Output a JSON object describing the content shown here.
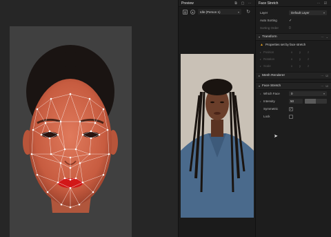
{
  "preview": {
    "title": "Preview",
    "device": "Idle (Person 1)",
    "toolbar_icons": [
      "frame-icon",
      "camera-icon",
      "refresh-icon"
    ]
  },
  "inspector": {
    "title": "Face Stretch",
    "layer_label": "Layer",
    "layer_value": "Default Layer",
    "auto_sorting_label": "Auto Sorting",
    "sorting_order_label": "Sorting Order",
    "transform": {
      "title": "Transform",
      "warning": "Properties set by face stretch",
      "position_label": "Position",
      "rotation_label": "Rotation",
      "scale_label": "Scale"
    },
    "mesh_renderer": {
      "title": "Mesh Renderer"
    },
    "face_stretch": {
      "title": "Face Stretch",
      "which_face_label": "Which Face",
      "which_face_value": "0",
      "intensity_label": "Intensity",
      "intensity_value": "50",
      "intensity_fraction": 0.5,
      "symmetric_label": "Symmetric",
      "lock_label": "Lock"
    }
  },
  "colors": {
    "warning": "#e5a020",
    "mesh": "#ffffff",
    "lips": "#d21818"
  }
}
